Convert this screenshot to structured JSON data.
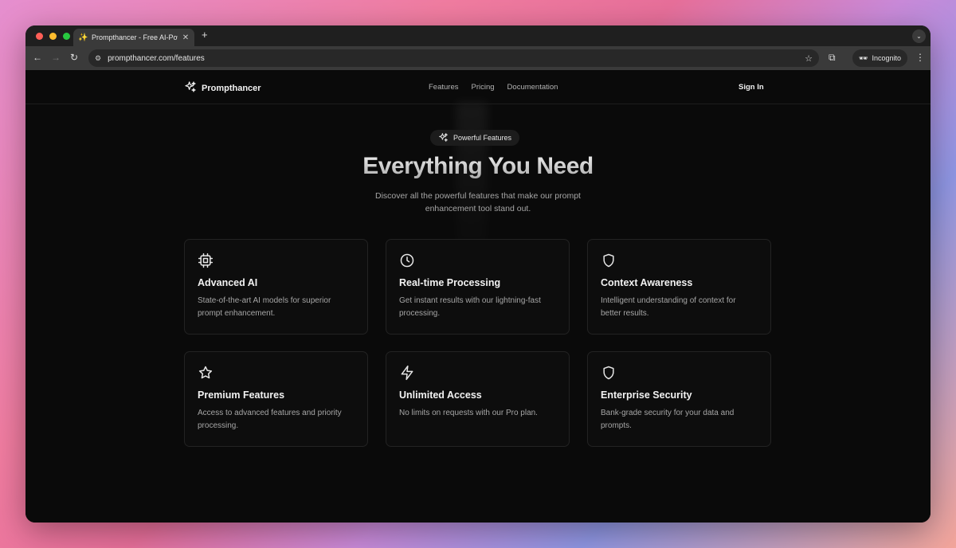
{
  "browser": {
    "tab_title": "Prompthancer - Free AI-Powe",
    "new_tab": "+",
    "url": "prompthancer.com/features",
    "incognito_label": "Incognito"
  },
  "nav": {
    "brand": "Prompthancer",
    "links": [
      "Features",
      "Pricing",
      "Documentation"
    ],
    "sign_in": "Sign In"
  },
  "hero": {
    "badge": "Powerful Features",
    "title": "Everything You Need",
    "subtitle": "Discover all the powerful features that make our prompt enhancement tool stand out."
  },
  "features": [
    {
      "icon": "cpu-icon",
      "title": "Advanced AI",
      "description": "State-of-the-art AI models for superior prompt enhancement."
    },
    {
      "icon": "clock-icon",
      "title": "Real-time Processing",
      "description": "Get instant results with our lightning-fast processing."
    },
    {
      "icon": "shield-icon",
      "title": "Context Awareness",
      "description": "Intelligent understanding of context for better results."
    },
    {
      "icon": "star-icon",
      "title": "Premium Features",
      "description": "Access to advanced features and priority processing."
    },
    {
      "icon": "lightning-icon",
      "title": "Unlimited Access",
      "description": "No limits on requests with our Pro plan."
    },
    {
      "icon": "shield-icon",
      "title": "Enterprise Security",
      "description": "Bank-grade security for your data and prompts."
    }
  ]
}
